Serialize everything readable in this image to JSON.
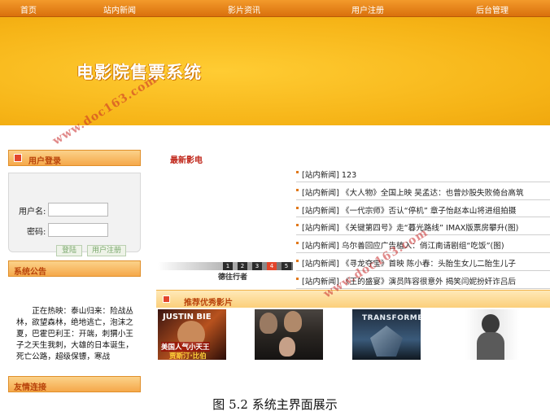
{
  "nav": {
    "items": [
      "首页",
      "站内新闻",
      "影片资讯",
      "用户注册",
      "后台管理"
    ]
  },
  "banner": {
    "title": "电影院售票系统"
  },
  "sidebar": {
    "login_header": "用户登录",
    "username_label": "用户名:",
    "password_label": "密码:",
    "login_button": "登陆",
    "register_button": "用户注册",
    "announce_header": "系统公告",
    "announce_text": "正在热映：泰山归来：险战丛林，欲望森林，绝地逃亡，泡沫之夏，巴霍巴利王：开端，刺猬小王子之天生我刺，大雄的日本诞生，死亡公路，超级保镖，寒战",
    "links_header": "友情连接"
  },
  "latest": {
    "title": "最新影电",
    "news": [
      "[站内新闻] 123",
      "[站内新闻] 《大人物》全国上映 吴孟达：也曾炒股失败倚台高筑",
      "[站内新闻] 《一代宗师》否认“停机” 章子怡赵本山将进组拍摄",
      "[站内新闻] 《关键第四号》走“暮光路线” IMAX版票房攀升(图)",
      "[站内新闻] 乌尔善回应广告植入：俏江南请剧组“吃饭”(图)",
      "[站内新闻] 《寻龙夺宝》首映 陈小春：头胎生女儿二胎生儿子",
      "[站内新闻] 《王的盛宴》演员阵容很意外 揭笑闫妮扮奸诈吕后"
    ]
  },
  "slideshow": {
    "numbers": [
      "1",
      "2",
      "3",
      "4",
      "5"
    ],
    "active_index": 3,
    "caption": "德往行者"
  },
  "recommended": {
    "header": "推荐优秀影片",
    "posters": [
      {
        "name": "justin-bieber-poster",
        "text_top": "JUSTIN BIE",
        "text_bottom": "美国人气小天王",
        "text_bottom2": "贾斯汀·比伯"
      },
      {
        "name": "drama-poster",
        "text_top": "",
        "text_bottom": "",
        "text_bottom2": ""
      },
      {
        "name": "transformers-poster",
        "text_top": "TRANSFORMERS",
        "text_bottom": "",
        "text_bottom2": ""
      },
      {
        "name": "portrait-poster",
        "text_top": "",
        "text_bottom": "",
        "text_bottom2": ""
      }
    ]
  },
  "watermark": "www.doc163.com",
  "caption": "图 5.2  系统主界面展示",
  "colors": {
    "nav_bg": "#e27e14",
    "banner_bg": "#f6b417",
    "accent_red": "#c0281c",
    "header_text": "#b8420a"
  }
}
